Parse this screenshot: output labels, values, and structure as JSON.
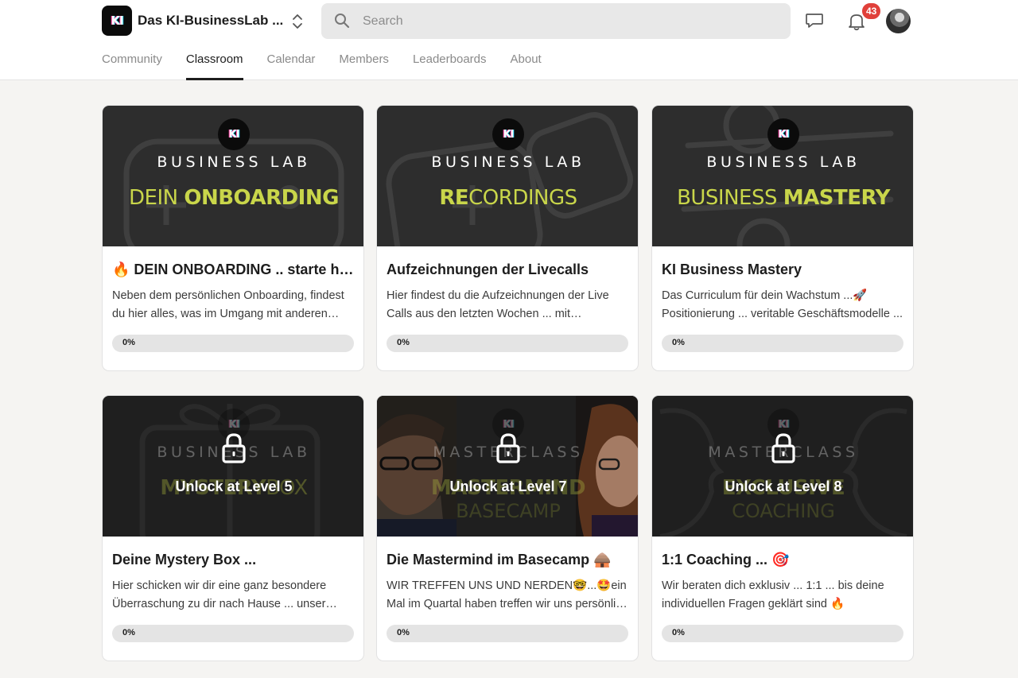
{
  "header": {
    "community_name": "Das KI-BusinessLab ...",
    "logo_text": "KI",
    "search_placeholder": "Search",
    "notification_count": "43"
  },
  "tabs": [
    {
      "label": "Community",
      "active": false
    },
    {
      "label": "Classroom",
      "active": true
    },
    {
      "label": "Calendar",
      "active": false
    },
    {
      "label": "Members",
      "active": false
    },
    {
      "label": "Leaderboards",
      "active": false
    },
    {
      "label": "About",
      "active": false
    }
  ],
  "colors": {
    "accent_lime": "#c9d64a",
    "badge_red": "#e0403a",
    "banner_bg": "#2d2d2d"
  },
  "courses": [
    {
      "banner_logo": "KI",
      "banner_brand": "BUSINESS LAB",
      "banner_title_thin": "DEIN ",
      "banner_title_bold": "ONBOARDING",
      "title": "🔥 DEIN ONBOARDING .. starte hier 🔥",
      "description": "Neben dem persönlichen Onboarding, findest du hier alles, was im Umgang mit anderen Mitgliedern wichtig ist.",
      "progress": 0,
      "progress_label": "0%"
    },
    {
      "banner_logo": "KI",
      "banner_brand": "BUSINESS LAB",
      "banner_title_bold": "RE",
      "banner_title_thin": "CORDINGS",
      "title": "Aufzeichnungen der Livecalls",
      "description": "Hier findest du die Aufzeichnungen der Live Calls aus den letzten Wochen ... mit Zusammenfassungen.",
      "progress": 0,
      "progress_label": "0%"
    },
    {
      "banner_logo": "KI",
      "banner_brand": "BUSINESS LAB",
      "banner_title_thin": "BUSINESS ",
      "banner_title_bold": "MASTERY",
      "title": "KI Business Mastery",
      "description": "Das Curriculum für dein Wachstum ...🚀 Positionierung ... veritable Geschäftsmodelle ...",
      "progress": 0,
      "progress_label": "0%"
    },
    {
      "banner_logo": "KI",
      "banner_brand": "BUSINESS LAB",
      "banner_title_bold": "MYSTERY",
      "banner_title_thin": "BOX",
      "lock_label": "Unlock at Level 5",
      "title": "Deine Mystery Box ...",
      "description": "Hier schicken wir dir eine ganz besondere Überraschung zu dir nach Hause ... unser Dankeschön.",
      "progress": 0,
      "progress_label": "0%"
    },
    {
      "banner_logo": "KI",
      "banner_brand": "MASTERCLASS",
      "banner_title_bold": "MASTERMIND",
      "banner_title_line2": "BASECAMP",
      "lock_label": "Unlock at Level 7",
      "title": "Die Mastermind im Basecamp 🛖",
      "description": "WIR TREFFEN UNS UND NERDEN🤓...🤩ein Mal im Quartal haben treffen wir uns persönlich ...",
      "progress": 0,
      "progress_label": "0%"
    },
    {
      "banner_logo": "KI",
      "banner_brand": "MASTERCLASS",
      "banner_title_bold": "EXCLUSIVE",
      "banner_title_line2": "COACHING",
      "lock_label": "Unlock at Level 8",
      "title": "1:1 Coaching ... 🎯",
      "description": "Wir beraten dich exklusiv ... 1:1 ... bis deine individuellen Fragen geklärt sind 🔥",
      "progress": 0,
      "progress_label": "0%"
    }
  ]
}
